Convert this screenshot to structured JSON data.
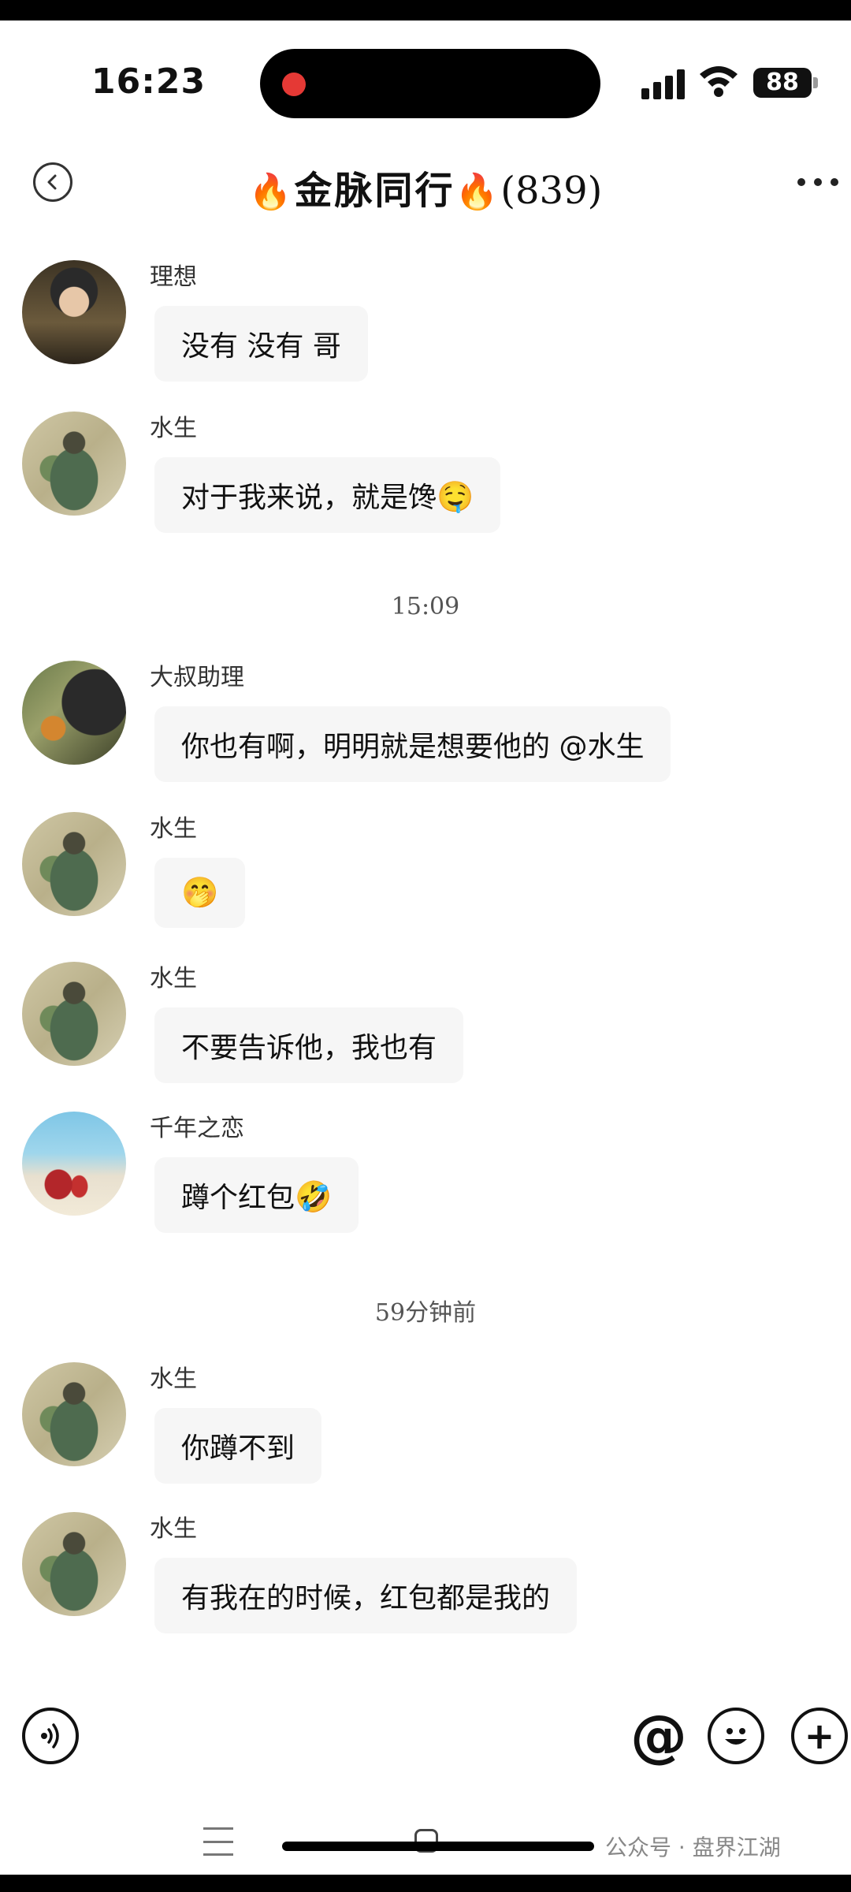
{
  "status_bar": {
    "time": "16:23",
    "battery": "88"
  },
  "header": {
    "fire_left": "🔥",
    "title": "金脉同行",
    "fire_right": "🔥",
    "member_count": "(839)"
  },
  "messages": [
    {
      "sender": "理想",
      "text": "没有 没有 哥",
      "emoji": ""
    },
    {
      "sender": "水生",
      "text": "对于我来说，就是馋",
      "emoji": "🤤"
    },
    {
      "sender": "大叔助理",
      "text": "你也有啊，明明就是想要他的 @水生",
      "emoji": ""
    },
    {
      "sender": "水生",
      "text": "",
      "emoji": "🤭"
    },
    {
      "sender": "水生",
      "text": "不要告诉他，我也有",
      "emoji": ""
    },
    {
      "sender": "千年之恋",
      "text": "蹲个红包",
      "emoji": "🤣"
    },
    {
      "sender": "水生",
      "text": "你蹲不到",
      "emoji": ""
    },
    {
      "sender": "水生",
      "text": "有我在的时候，红包都是我的",
      "emoji": ""
    }
  ],
  "timestamps": [
    "15:09",
    "59分钟前"
  ],
  "input_bar": {
    "at_symbol": "@",
    "plus_symbol": "+"
  },
  "watermark": "公众号 · 盘界江湖"
}
